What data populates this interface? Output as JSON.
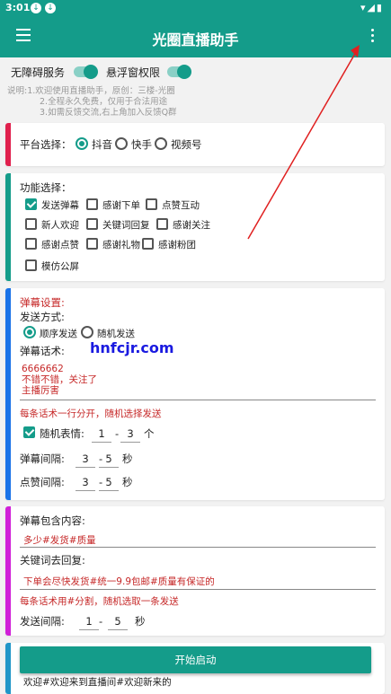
{
  "status_bar": {
    "time": "3:01",
    "download_icons": [
      "↓",
      "↓"
    ]
  },
  "app_bar": {
    "title": "光圈直播助手"
  },
  "toggles": {
    "accessibility_label": "无障碍服务",
    "overlay_label": "悬浮窗权限"
  },
  "hint": {
    "line1": "说明:1.欢迎使用直播助手，原创：三楼-光圈",
    "line2": "2.全程永久免费，仅用于合法用途",
    "line3": "3.如需反馈交流,右上角加入反馈Q群"
  },
  "platform": {
    "label": "平台选择：",
    "options": [
      "抖音",
      "快手",
      "视频号"
    ],
    "selected": "抖音"
  },
  "features": {
    "label": "功能选择：",
    "items": [
      "发送弹幕",
      "感谢下单",
      "点赞互动",
      "新人欢迎",
      "关键词回复",
      "感谢关注",
      "感谢点赞",
      "感谢礼物",
      "感谢粉团",
      "模仿公屏"
    ],
    "checked": [
      "发送弹幕"
    ]
  },
  "danmu": {
    "section_title": "弹幕设置:",
    "send_mode_label": "发送方式:",
    "modes": [
      "顺序发送",
      "随机发送"
    ],
    "selected_mode": "顺序发送",
    "script_label": "弹幕话术:",
    "script_lines": [
      "6666662",
      "不错不错，关注了",
      "主播厉害"
    ],
    "script_hint": "每条话术一行分开，随机选择发送",
    "emoji_label": "随机表情:",
    "emoji_min": "1",
    "emoji_max": "3",
    "emoji_unit": "个",
    "interval_label": "弹幕间隔:",
    "interval_min": "3",
    "interval_max": "5",
    "like_interval_label": "点赞间隔:",
    "like_min": "3",
    "like_max": "5",
    "sec": "秒",
    "dash": "-"
  },
  "keyword": {
    "contains_label": "弹幕包含内容:",
    "contains_value": "多少#发货#质量",
    "reply_label": "关键词去回复:",
    "reply_value": "下单会尽快发货#统一9.9包邮#质量有保证的",
    "hint": "每条话术用#分割，随机选取一条发送",
    "interval_label": "发送间隔:",
    "interval_min": "1",
    "interval_max": "5",
    "sec": "秒",
    "dash": "-"
  },
  "welcome": {
    "value": "欢迎#欢迎来到直播间#欢迎新来的"
  },
  "start_button": "开始启动",
  "watermark": "hnfcjr.com",
  "colors": {
    "primary": "#149c8a",
    "card1": "#e0204d",
    "card2": "#149c8a",
    "card3": "#1a73e8",
    "card4": "#d020d8",
    "card5": "#2196c8",
    "hint_red": "#c62828",
    "arrow": "#e02020"
  }
}
